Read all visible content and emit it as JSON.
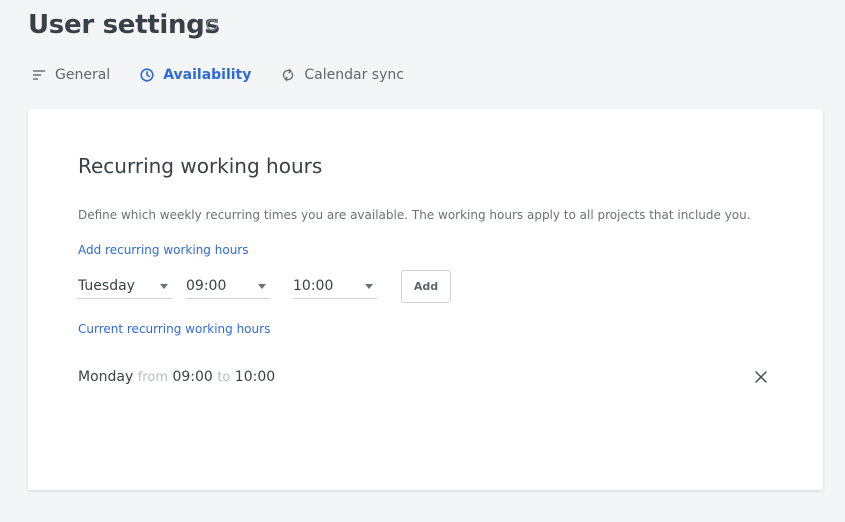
{
  "header": {
    "title": "User settings",
    "refresh_icon": "refresh-icon"
  },
  "tabs": [
    {
      "label": "General",
      "icon": "sort-lines-icon",
      "active": false
    },
    {
      "label": "Availability",
      "icon": "clock-icon",
      "active": true
    },
    {
      "label": "Calendar sync",
      "icon": "sync-icon",
      "active": false
    }
  ],
  "card": {
    "title": "Recurring working hours",
    "description": "Define which weekly recurring times you are available. The working hours apply to all projects that include you.",
    "add_section_label": "Add recurring working hours",
    "form": {
      "day": "Tuesday",
      "start": "09:00",
      "end": "10:00",
      "add_label": "Add"
    },
    "current_section_label": "Current recurring working hours",
    "current_hours": [
      {
        "day": "Monday",
        "from_word": "from",
        "start": "09:00",
        "to_word": "to",
        "end": "10:00"
      }
    ]
  },
  "colors": {
    "accent": "#2f6bd6",
    "background": "#f4f5f7",
    "card": "#ffffff",
    "text": "#3c4248",
    "muted": "#b9bdc2"
  }
}
